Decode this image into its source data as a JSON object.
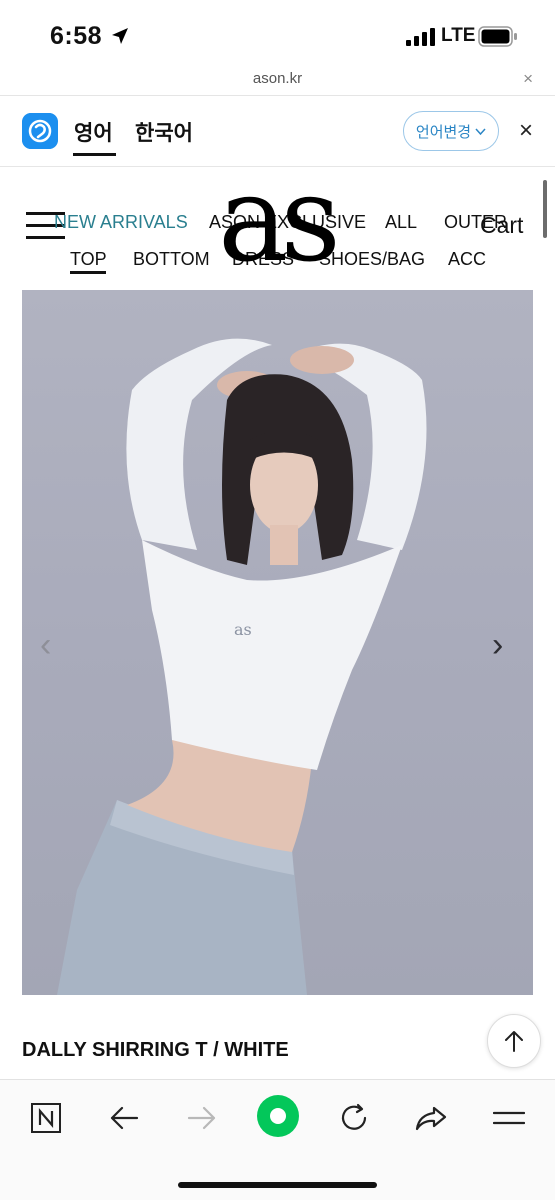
{
  "status_bar": {
    "time": "6:58",
    "network": "LTE",
    "icons": [
      "location-arrow-icon",
      "signal-icon",
      "battery-icon"
    ]
  },
  "url_bar": {
    "domain": "ason.kr",
    "close_label": "×"
  },
  "translate_bar": {
    "icon": "papago-icon",
    "tabs": [
      {
        "label": "영어",
        "active": true
      },
      {
        "label": "한국어",
        "active": false
      }
    ],
    "change_language_label": "언어변경",
    "close_label": "×"
  },
  "header": {
    "logo_text": "as",
    "cart_label": "Cart",
    "nav_row1": [
      "NEW ARRIVALS",
      "ASON EXCLUSIVE",
      "ALL",
      "OUTER"
    ],
    "nav_row2": [
      "TOP",
      "BOTTOM",
      "DRESS",
      "SHOES/BAG",
      "ACC"
    ],
    "active_color": "#2a7f8f"
  },
  "product": {
    "name": "DALLY SHIRRING T / WHITE",
    "image_description": "model in white cropped long-sleeve top and light blue denim",
    "prev_label": "‹",
    "next_label": "›"
  },
  "toolbar": {
    "items": [
      "naver-n-icon",
      "back-arrow-icon",
      "forward-arrow-icon",
      "green-home-icon",
      "refresh-icon",
      "share-icon",
      "menu-icon"
    ],
    "accent": "#03c75a"
  }
}
